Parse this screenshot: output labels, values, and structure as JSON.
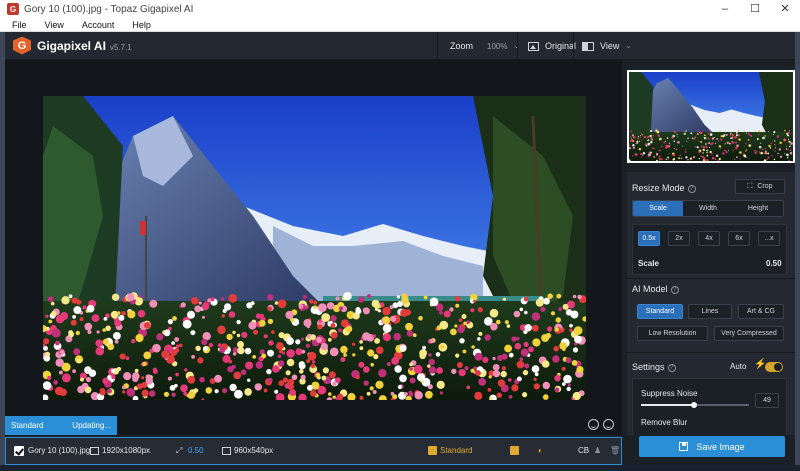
{
  "window": {
    "title": "Gory 10 (100).jpg - Topaz Gigapixel AI",
    "controls": [
      "–",
      "☐",
      "✕"
    ]
  },
  "menu": [
    "File",
    "View",
    "Account",
    "Help"
  ],
  "header": {
    "app_name": "Gigapixel AI",
    "version": "v5.7.1",
    "zoom_label": "Zoom",
    "zoom_value": "100%",
    "original_label": "Original",
    "view_label": "View"
  },
  "status": {
    "mode": "Standard",
    "state": "Updating..."
  },
  "file": {
    "name": "Gory 10 (100).jpg",
    "input_size": "1920x1080px",
    "scale": "0.50",
    "output_size": "960x540px",
    "model": "Standard",
    "cb": "CB"
  },
  "panel": {
    "resize_mode_title": "Resize Mode",
    "crop_label": "Crop",
    "resize_tabs": [
      {
        "label": "Scale",
        "active": true
      },
      {
        "label": "Width",
        "active": false
      },
      {
        "label": "Height",
        "active": false
      }
    ],
    "scale_presets": [
      {
        "label": "0.5x",
        "active": true
      },
      {
        "label": "2x",
        "active": false
      },
      {
        "label": "4x",
        "active": false
      },
      {
        "label": "6x",
        "active": false
      },
      {
        "label": "...x",
        "active": false
      }
    ],
    "scale_label": "Scale",
    "scale_value": "0.50",
    "ai_model_title": "AI Model",
    "models": [
      {
        "label": "Standard",
        "active": true
      },
      {
        "label": "Lines",
        "active": false
      },
      {
        "label": "Art & CG",
        "active": false
      },
      {
        "label": "Low Resolution",
        "active": false
      },
      {
        "label": "Very Compressed",
        "active": false
      }
    ],
    "settings_title": "Settings",
    "auto_label": "Auto",
    "auto_on": true,
    "suppress_noise_label": "Suppress Noise",
    "suppress_noise_value": "49",
    "suppress_noise_level": 0.49,
    "remove_blur_label": "Remove Blur"
  },
  "save_label": "Save Image",
  "colors": {
    "accent": "#2a8fd6",
    "active_button": "#2a6fb8",
    "gold": "#e0a82e",
    "panel_bg": "#232831"
  }
}
